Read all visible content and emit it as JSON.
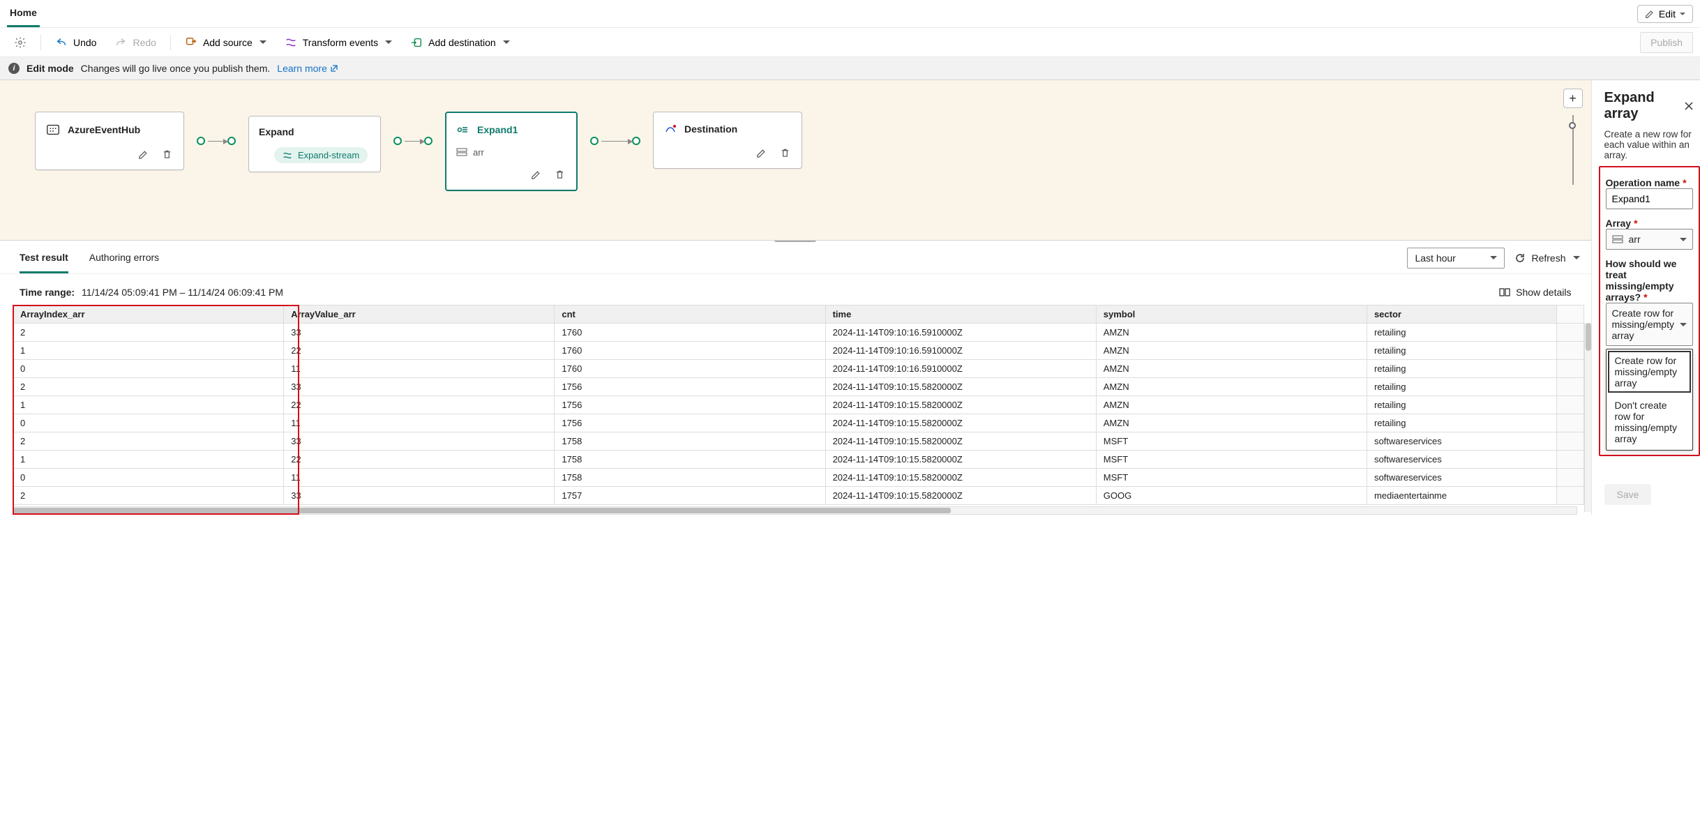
{
  "tabs": {
    "home": "Home",
    "edit": "Edit"
  },
  "toolbar": {
    "undo": "Undo",
    "redo": "Redo",
    "add_source": "Add source",
    "transform": "Transform events",
    "add_dest": "Add destination",
    "publish": "Publish"
  },
  "info_bar": {
    "title": "Edit mode",
    "msg": "Changes will go live once you publish them.",
    "learn_more": "Learn more"
  },
  "graph": {
    "source": {
      "title": "AzureEventHub"
    },
    "expand": {
      "title": "Expand",
      "chip": "Expand-stream"
    },
    "expand1": {
      "title": "Expand1",
      "arr": "arr"
    },
    "dest": {
      "title": "Destination"
    }
  },
  "results": {
    "tabs": {
      "test": "Test result",
      "errors": "Authoring errors"
    },
    "time_filter": "Last hour",
    "refresh": "Refresh",
    "time_range_label": "Time range:",
    "time_range_value": "11/14/24 05:09:41 PM – 11/14/24 06:09:41 PM",
    "show_details": "Show details"
  },
  "table": {
    "columns": [
      "ArrayIndex_arr",
      "ArrayValue_arr",
      "cnt",
      "time",
      "symbol",
      "sector"
    ],
    "rows": [
      [
        "2",
        "33",
        "1760",
        "2024-11-14T09:10:16.5910000Z",
        "AMZN",
        "retailing"
      ],
      [
        "1",
        "22",
        "1760",
        "2024-11-14T09:10:16.5910000Z",
        "AMZN",
        "retailing"
      ],
      [
        "0",
        "11",
        "1760",
        "2024-11-14T09:10:16.5910000Z",
        "AMZN",
        "retailing"
      ],
      [
        "2",
        "33",
        "1756",
        "2024-11-14T09:10:15.5820000Z",
        "AMZN",
        "retailing"
      ],
      [
        "1",
        "22",
        "1756",
        "2024-11-14T09:10:15.5820000Z",
        "AMZN",
        "retailing"
      ],
      [
        "0",
        "11",
        "1756",
        "2024-11-14T09:10:15.5820000Z",
        "AMZN",
        "retailing"
      ],
      [
        "2",
        "33",
        "1758",
        "2024-11-14T09:10:15.5820000Z",
        "MSFT",
        "softwareservices"
      ],
      [
        "1",
        "22",
        "1758",
        "2024-11-14T09:10:15.5820000Z",
        "MSFT",
        "softwareservices"
      ],
      [
        "0",
        "11",
        "1758",
        "2024-11-14T09:10:15.5820000Z",
        "MSFT",
        "softwareservices"
      ],
      [
        "2",
        "33",
        "1757",
        "2024-11-14T09:10:15.5820000Z",
        "GOOG",
        "mediaentertainme"
      ]
    ]
  },
  "side": {
    "title": "Expand array",
    "subtitle": "Create a new row for each value within an array.",
    "op_name_label": "Operation name",
    "op_name_value": "Expand1",
    "array_label": "Array",
    "array_value": "arr",
    "missing_label": "How should we treat missing/empty arrays?",
    "missing_value": "Create row for missing/empty array",
    "options": [
      "Create row for missing/empty array",
      "Don't create row for missing/empty array"
    ],
    "save": "Save"
  }
}
